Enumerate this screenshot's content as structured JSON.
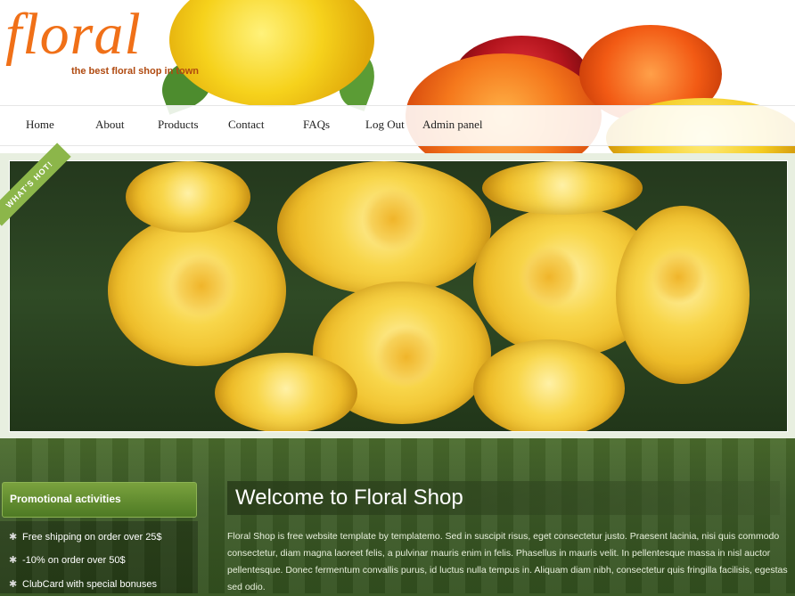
{
  "brand": {
    "name": "floral",
    "tagline": "the best floral shop in town"
  },
  "nav": {
    "items": [
      "Home",
      "About",
      "Products",
      "Contact",
      "FAQs",
      "Log Out",
      "Admin panel"
    ]
  },
  "banner": {
    "ribbon": "WHAT'S HOT!"
  },
  "sidebar": {
    "title": "Promotional activities",
    "items": [
      "Free shipping on order over 25$",
      "-10% on order over 50$",
      "ClubCard with special bonuses"
    ],
    "bullet_icon": "star-icon"
  },
  "main": {
    "title": "Welcome to Floral Shop",
    "body": "Floral Shop is free website template by templatemo. Sed in suscipit risus, eget consectetur justo. Praesent lacinia, nisi quis commodo consectetur, diam magna laoreet felis, a pulvinar mauris enim in felis. Phasellus in mauris velit. In pellentesque massa in nisl auctor pellentesque. Donec fermentum convallis purus, id luctus nulla tempus in. Aliquam diam nibh, consectetur quis fringilla facilisis, egestas sed odio."
  },
  "colors": {
    "logo": "#f07018",
    "promo_header": "#5e8a2c",
    "page_bg": "#3c5a27"
  }
}
